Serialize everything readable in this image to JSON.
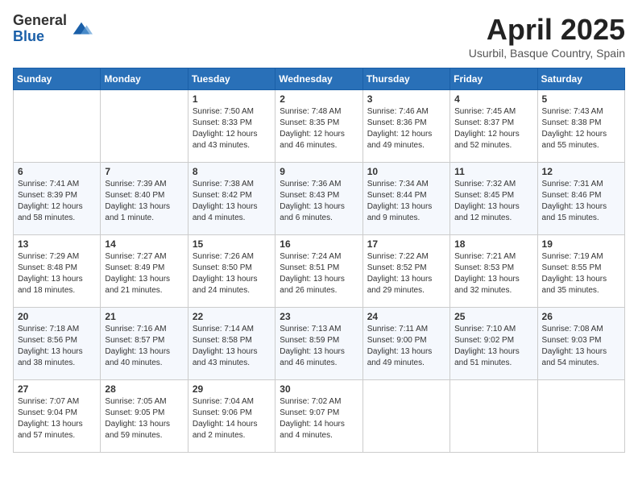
{
  "header": {
    "logo_general": "General",
    "logo_blue": "Blue",
    "month_title": "April 2025",
    "location": "Usurbil, Basque Country, Spain"
  },
  "days_of_week": [
    "Sunday",
    "Monday",
    "Tuesday",
    "Wednesday",
    "Thursday",
    "Friday",
    "Saturday"
  ],
  "weeks": [
    [
      {
        "day": "",
        "info": ""
      },
      {
        "day": "",
        "info": ""
      },
      {
        "day": "1",
        "info": "Sunrise: 7:50 AM\nSunset: 8:33 PM\nDaylight: 12 hours and 43 minutes."
      },
      {
        "day": "2",
        "info": "Sunrise: 7:48 AM\nSunset: 8:35 PM\nDaylight: 12 hours and 46 minutes."
      },
      {
        "day": "3",
        "info": "Sunrise: 7:46 AM\nSunset: 8:36 PM\nDaylight: 12 hours and 49 minutes."
      },
      {
        "day": "4",
        "info": "Sunrise: 7:45 AM\nSunset: 8:37 PM\nDaylight: 12 hours and 52 minutes."
      },
      {
        "day": "5",
        "info": "Sunrise: 7:43 AM\nSunset: 8:38 PM\nDaylight: 12 hours and 55 minutes."
      }
    ],
    [
      {
        "day": "6",
        "info": "Sunrise: 7:41 AM\nSunset: 8:39 PM\nDaylight: 12 hours and 58 minutes."
      },
      {
        "day": "7",
        "info": "Sunrise: 7:39 AM\nSunset: 8:40 PM\nDaylight: 13 hours and 1 minute."
      },
      {
        "day": "8",
        "info": "Sunrise: 7:38 AM\nSunset: 8:42 PM\nDaylight: 13 hours and 4 minutes."
      },
      {
        "day": "9",
        "info": "Sunrise: 7:36 AM\nSunset: 8:43 PM\nDaylight: 13 hours and 6 minutes."
      },
      {
        "day": "10",
        "info": "Sunrise: 7:34 AM\nSunset: 8:44 PM\nDaylight: 13 hours and 9 minutes."
      },
      {
        "day": "11",
        "info": "Sunrise: 7:32 AM\nSunset: 8:45 PM\nDaylight: 13 hours and 12 minutes."
      },
      {
        "day": "12",
        "info": "Sunrise: 7:31 AM\nSunset: 8:46 PM\nDaylight: 13 hours and 15 minutes."
      }
    ],
    [
      {
        "day": "13",
        "info": "Sunrise: 7:29 AM\nSunset: 8:48 PM\nDaylight: 13 hours and 18 minutes."
      },
      {
        "day": "14",
        "info": "Sunrise: 7:27 AM\nSunset: 8:49 PM\nDaylight: 13 hours and 21 minutes."
      },
      {
        "day": "15",
        "info": "Sunrise: 7:26 AM\nSunset: 8:50 PM\nDaylight: 13 hours and 24 minutes."
      },
      {
        "day": "16",
        "info": "Sunrise: 7:24 AM\nSunset: 8:51 PM\nDaylight: 13 hours and 26 minutes."
      },
      {
        "day": "17",
        "info": "Sunrise: 7:22 AM\nSunset: 8:52 PM\nDaylight: 13 hours and 29 minutes."
      },
      {
        "day": "18",
        "info": "Sunrise: 7:21 AM\nSunset: 8:53 PM\nDaylight: 13 hours and 32 minutes."
      },
      {
        "day": "19",
        "info": "Sunrise: 7:19 AM\nSunset: 8:55 PM\nDaylight: 13 hours and 35 minutes."
      }
    ],
    [
      {
        "day": "20",
        "info": "Sunrise: 7:18 AM\nSunset: 8:56 PM\nDaylight: 13 hours and 38 minutes."
      },
      {
        "day": "21",
        "info": "Sunrise: 7:16 AM\nSunset: 8:57 PM\nDaylight: 13 hours and 40 minutes."
      },
      {
        "day": "22",
        "info": "Sunrise: 7:14 AM\nSunset: 8:58 PM\nDaylight: 13 hours and 43 minutes."
      },
      {
        "day": "23",
        "info": "Sunrise: 7:13 AM\nSunset: 8:59 PM\nDaylight: 13 hours and 46 minutes."
      },
      {
        "day": "24",
        "info": "Sunrise: 7:11 AM\nSunset: 9:00 PM\nDaylight: 13 hours and 49 minutes."
      },
      {
        "day": "25",
        "info": "Sunrise: 7:10 AM\nSunset: 9:02 PM\nDaylight: 13 hours and 51 minutes."
      },
      {
        "day": "26",
        "info": "Sunrise: 7:08 AM\nSunset: 9:03 PM\nDaylight: 13 hours and 54 minutes."
      }
    ],
    [
      {
        "day": "27",
        "info": "Sunrise: 7:07 AM\nSunset: 9:04 PM\nDaylight: 13 hours and 57 minutes."
      },
      {
        "day": "28",
        "info": "Sunrise: 7:05 AM\nSunset: 9:05 PM\nDaylight: 13 hours and 59 minutes."
      },
      {
        "day": "29",
        "info": "Sunrise: 7:04 AM\nSunset: 9:06 PM\nDaylight: 14 hours and 2 minutes."
      },
      {
        "day": "30",
        "info": "Sunrise: 7:02 AM\nSunset: 9:07 PM\nDaylight: 14 hours and 4 minutes."
      },
      {
        "day": "",
        "info": ""
      },
      {
        "day": "",
        "info": ""
      },
      {
        "day": "",
        "info": ""
      }
    ]
  ]
}
